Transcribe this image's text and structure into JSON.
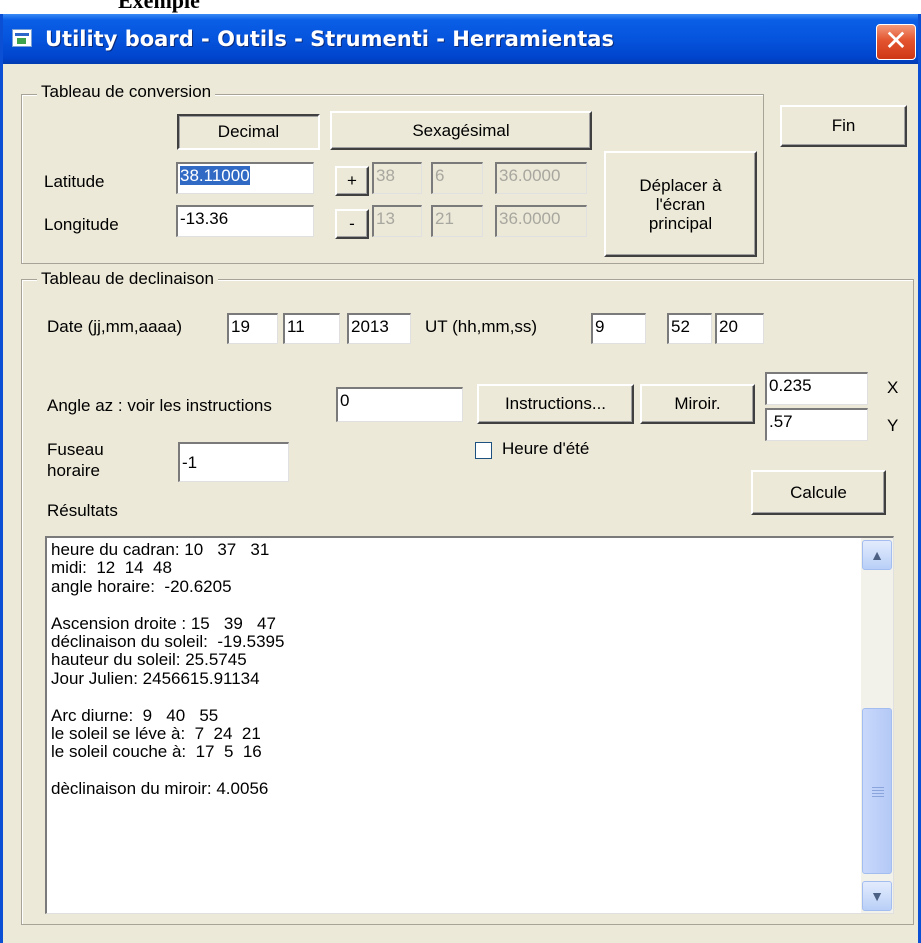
{
  "page_heading": "Exemple",
  "window": {
    "title": "Utility board - Outils - Strumenti - Herramientas",
    "close_glyph": "✕"
  },
  "conversion": {
    "legend": "Tableau de conversion",
    "decimal_button": "Decimal",
    "sexagesimal_button": "Sexagésimal",
    "latitude_label": "Latitude",
    "longitude_label": "Longitude",
    "latitude_decimal": "38.11000",
    "longitude_decimal": "-13.36",
    "lat_sign": "+",
    "lon_sign": "-",
    "lat_deg": "38",
    "lat_min": "6",
    "lat_sec": "36.0000",
    "lon_deg": "13",
    "lon_min": "21",
    "lon_sec": "36.0000",
    "move_button": "Déplacer à l'écran principal"
  },
  "fin_button": "Fin",
  "declinaison": {
    "legend": "Tableau de declinaison",
    "date_label": "Date (jj,mm,aaaa)",
    "day": "19",
    "month": "11",
    "year": "2013",
    "ut_label": "UT (hh,mm,ss)",
    "hour": "9",
    "minute": "52",
    "second": "20",
    "angle_label": "Angle az : voir les instructions",
    "angle_value": "0",
    "instructions_button": "Instructions...",
    "miroir_button": "Miroir.",
    "x_value": "0.235",
    "x_label": "X",
    "y_value": ".57",
    "y_label": "Y",
    "fuseau_label": "Fuseau horaire",
    "fuseau_value": "-1",
    "heure_ete_label": "Heure d'été",
    "heure_ete_checked": false,
    "calcule_button": "Calcule",
    "resultats_label": "Résultats",
    "results_lines": [
      "heure du cadran: 10   37   31",
      "midi:  12  14  48",
      "angle horaire:  -20.6205",
      "",
      "Ascension droite : 15   39   47",
      "déclinaison du soleil:  -19.5395",
      "hauteur du soleil: 25.5745",
      "Jour Julien: 2456615.91134",
      "",
      "Arc diurne:  9   40   55",
      "le soleil se léve à:  7  24  21",
      "le soleil couche à:  17  5  16",
      "",
      "dèclinaison du miroir: 4.0056"
    ],
    "scroll_up_glyph": "▲",
    "scroll_down_glyph": "▼"
  }
}
